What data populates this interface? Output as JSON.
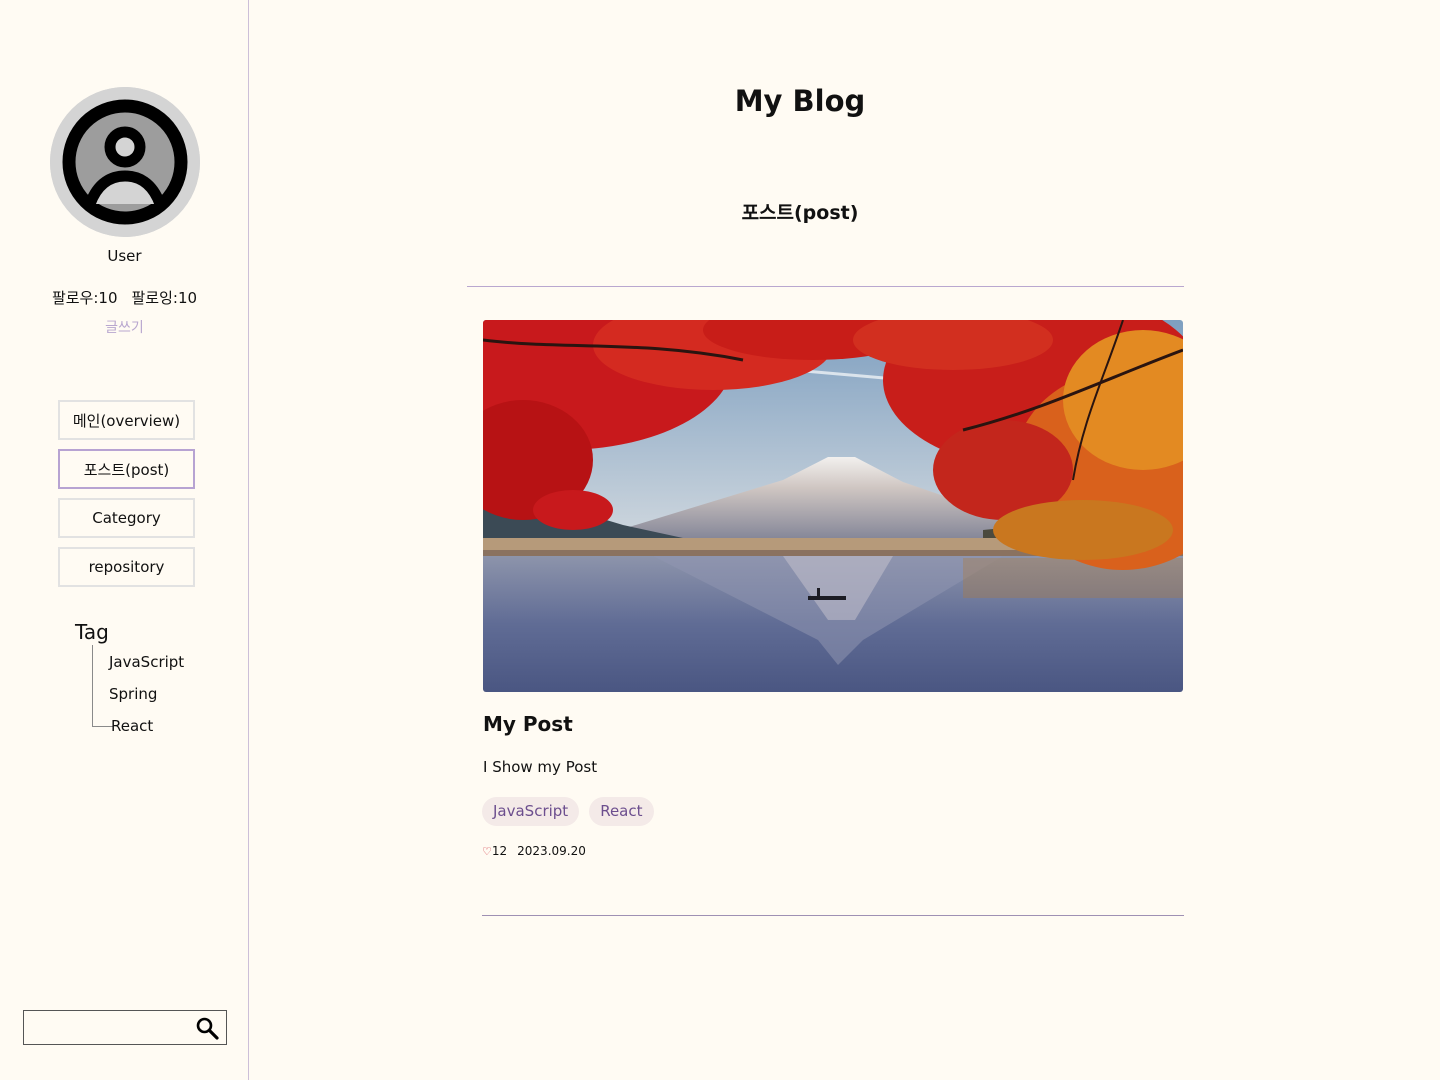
{
  "app": {
    "title": "My Blog"
  },
  "profile": {
    "username": "User",
    "followers": "팔로우:10",
    "following": "팔로잉:10",
    "write_label": "글쓰기"
  },
  "nav": {
    "items": [
      {
        "label": "메인(overview)"
      },
      {
        "label": "포스트(post)",
        "active": true
      },
      {
        "label": "Category"
      },
      {
        "label": "repository"
      }
    ]
  },
  "tags": {
    "heading": "Tag",
    "items": [
      "JavaScript",
      "Spring",
      "React"
    ]
  },
  "search": {
    "value": "",
    "icon": "search-icon"
  },
  "main": {
    "section_title": "포스트(post)"
  },
  "post": {
    "image_alt": "Mount Fuji with autumn maple leaves and lake reflection",
    "title": "My Post",
    "excerpt": "I Show my Post",
    "tags": [
      "JavaScript",
      "React"
    ],
    "likes": "12",
    "date": "2023.09.20",
    "like_icon": "heart-icon"
  },
  "colors": {
    "background": "#fffbf3",
    "accent": "#b9a7cf",
    "tag_chip_bg": "#f4eae8",
    "tag_chip_text": "#6c4e8e",
    "heart": "#d2333f"
  }
}
